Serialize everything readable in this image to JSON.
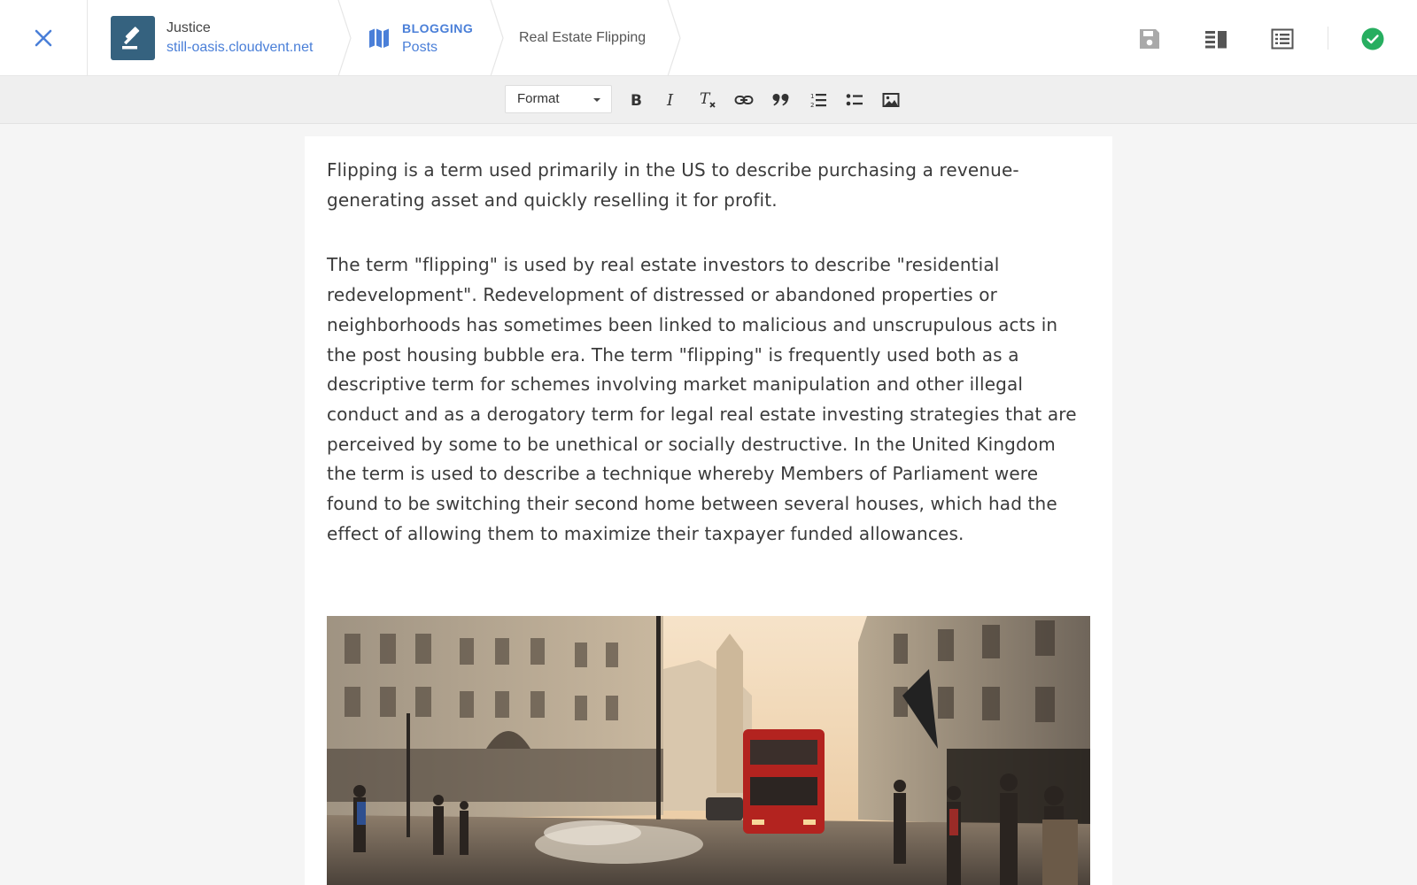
{
  "header": {
    "site": {
      "name": "Justice",
      "url": "still-oasis.cloudvent.net"
    },
    "section": {
      "category": "BLOGGING",
      "name": "Posts"
    },
    "document_title": "Real Estate Flipping",
    "icons": {
      "close": "close-icon",
      "site_logo": "gavel-icon",
      "section": "map-icon",
      "save": "save-icon",
      "split_view": "split-view-icon",
      "details": "details-list-icon",
      "status": "check-circle-icon"
    },
    "status_color": "#27ae60",
    "accent_color": "#4a7fd8"
  },
  "toolbar": {
    "format_label": "Format",
    "buttons": [
      "bold",
      "italic",
      "clear-formatting",
      "link",
      "blockquote",
      "ordered-list",
      "unordered-list",
      "image"
    ]
  },
  "content": {
    "paragraphs": [
      "Flipping is a term used primarily in the US to describe purchasing a revenue-generating asset and quickly reselling it for profit.",
      "The term \"flipping\" is used by real estate investors to describe \"residential redevelopment\". Redevelopment of distressed or abandoned properties or neighborhoods has sometimes been linked to malicious and unscrupulous acts in the post housing bubble era. The term \"flipping\" is frequently used both as a descriptive term for schemes involving market manipulation and other illegal conduct and as a derogatory term for legal real estate investing strategies that are perceived by some to be unethical or socially destructive. In the United Kingdom the term is used to describe a technique whereby Members of Parliament were found to be switching their second home between several houses, which had the effect of allowing them to maximize their taxpayer funded allowances."
    ],
    "image_subject": "london-street-photo"
  }
}
